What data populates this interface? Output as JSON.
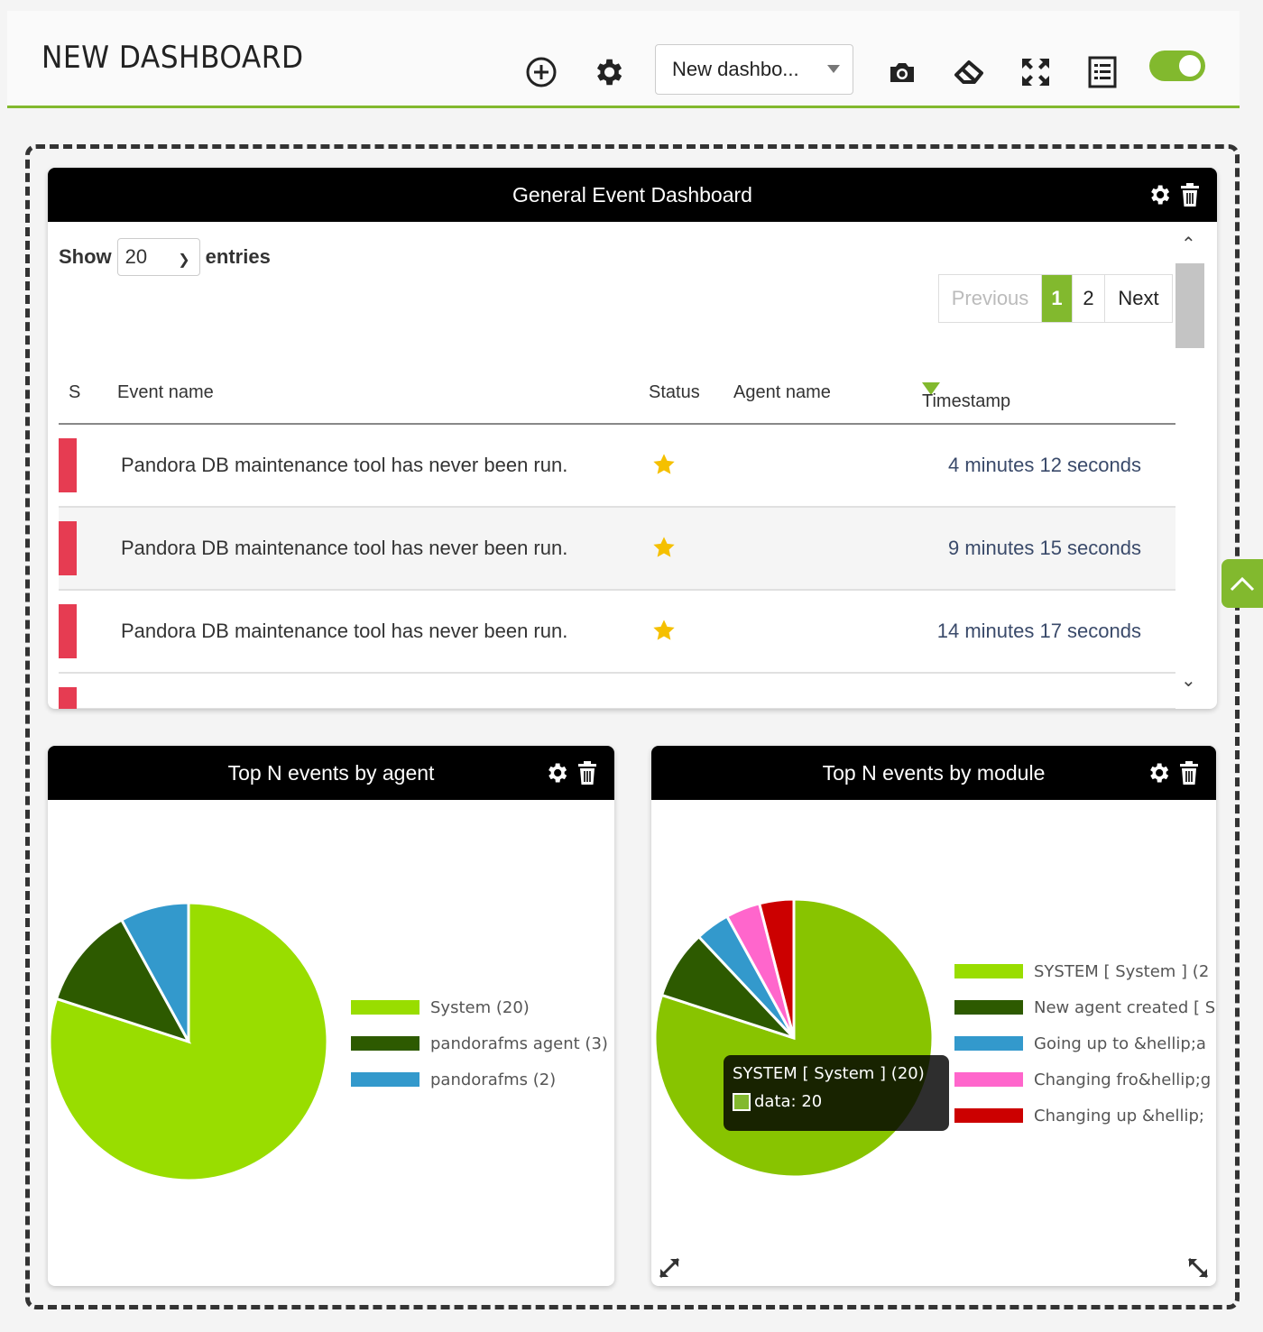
{
  "header": {
    "title": "NEW DASHBOARD",
    "dashboard_select": "New dashbo...",
    "icons": [
      "add-circle-icon",
      "gear-icon",
      "camera-icon",
      "eraser-icon",
      "fullscreen-icon",
      "list-icon",
      "toggle-switch"
    ],
    "accent": "#82b92e"
  },
  "events_widget": {
    "title": "General Event Dashboard",
    "show_label": "Show",
    "show_value": "20",
    "entries_label": "entries",
    "pager": {
      "previous": "Previous",
      "page1": "1",
      "page2": "2",
      "next": "Next"
    },
    "columns": {
      "s": "S",
      "event_name": "Event name",
      "status": "Status",
      "agent_name": "Agent name",
      "timestamp": "Timestamp"
    },
    "rows": [
      {
        "event": "Pandora DB maintenance tool has never been run.",
        "timestamp": "4 minutes 12 seconds"
      },
      {
        "event": "Pandora DB maintenance tool has never been run.",
        "timestamp": "9 minutes 15 seconds"
      },
      {
        "event": "Pandora DB maintenance tool has never been run.",
        "timestamp": "14 minutes 17 seconds"
      }
    ],
    "severity_color": "#e63c52"
  },
  "agent_widget": {
    "title": "Top N events by agent",
    "legend": [
      {
        "label": "System (20)",
        "color": "#99dd00"
      },
      {
        "label": "pandorafms agent (3)",
        "color": "#2d5a00"
      },
      {
        "label": "pandorafms (2)",
        "color": "#3399cc"
      }
    ]
  },
  "module_widget": {
    "title": "Top N events by module",
    "legend": [
      {
        "label": "SYSTEM [ System ] (2",
        "color": "#99dd00"
      },
      {
        "label": "New agent created [ S",
        "color": "#2d5a00"
      },
      {
        "label": "Going up to &hellip;a",
        "color": "#3399cc"
      },
      {
        "label": "Changing fro&hellip;g",
        "color": "#ff66cc"
      },
      {
        "label": "Changing up &hellip;",
        "color": "#cc0000"
      }
    ],
    "tooltip": {
      "title": "SYSTEM [ System ] (20)",
      "value": "data: 20"
    }
  },
  "chart_data": [
    {
      "type": "pie",
      "categories": [
        "System",
        "pandorafms agent",
        "pandorafms"
      ],
      "values": [
        20,
        3,
        2
      ]
    },
    {
      "type": "pie",
      "categories": [
        "SYSTEM [ System ]",
        "New agent created",
        "Going up to",
        "Changing fro",
        "Changing up"
      ],
      "values": [
        20,
        2,
        1,
        1,
        1
      ]
    }
  ]
}
